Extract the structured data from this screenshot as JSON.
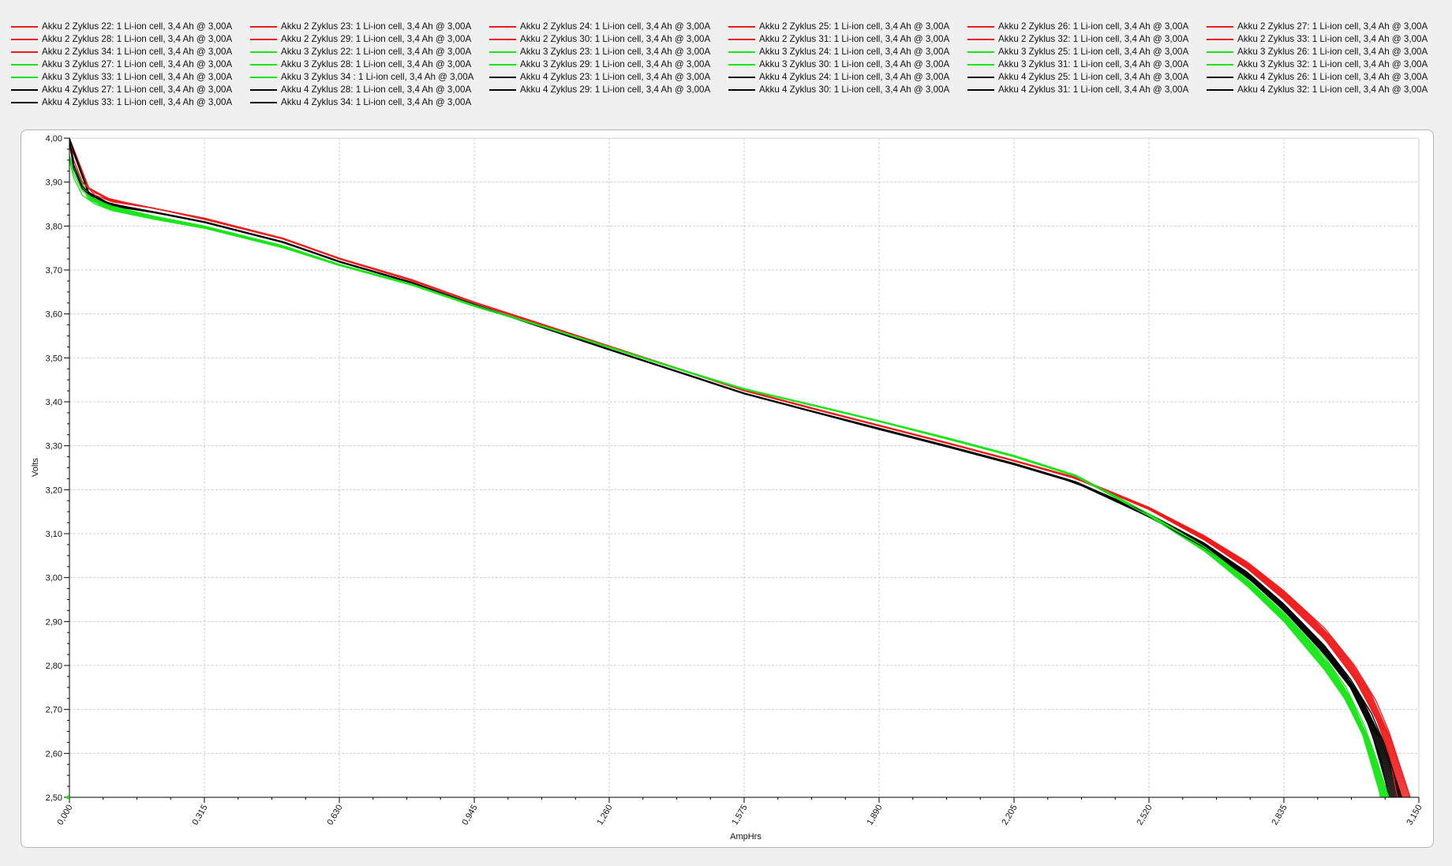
{
  "colors": {
    "red": "#ee1c1c",
    "green": "#19e619",
    "black": "#000000"
  },
  "legend": [
    {
      "label": "Akku 2 Zyklus 22: 1 Li-ion cell, 3,4 Ah @ 3,00A",
      "color": "red"
    },
    {
      "label": "Akku 2 Zyklus 23: 1 Li-ion cell, 3,4 Ah @ 3,00A",
      "color": "red"
    },
    {
      "label": "Akku 2 Zyklus 24: 1 Li-ion cell, 3,4 Ah @ 3,00A",
      "color": "red"
    },
    {
      "label": "Akku 2 Zyklus 25: 1 Li-ion cell, 3,4 Ah @ 3,00A",
      "color": "red"
    },
    {
      "label": "Akku 2 Zyklus 26: 1 Li-ion cell, 3,4 Ah @ 3,00A",
      "color": "red"
    },
    {
      "label": "Akku 2 Zyklus 27: 1 Li-ion cell, 3,4 Ah @ 3,00A",
      "color": "red"
    },
    {
      "label": "Akku 2 Zyklus 28: 1 Li-ion cell, 3,4 Ah @ 3,00A",
      "color": "red"
    },
    {
      "label": "Akku 2 Zyklus 29: 1 Li-ion cell, 3,4 Ah @ 3,00A",
      "color": "red"
    },
    {
      "label": "Akku 2 Zyklus 30: 1 Li-ion cell, 3,4 Ah @ 3,00A",
      "color": "red"
    },
    {
      "label": "Akku 2 Zyklus 31: 1 Li-ion cell, 3,4 Ah @ 3,00A",
      "color": "red"
    },
    {
      "label": "Akku 2 Zyklus 32: 1 Li-ion cell, 3,4 Ah @ 3,00A",
      "color": "red"
    },
    {
      "label": "Akku 2 Zyklus 33: 1 Li-ion cell, 3,4 Ah @ 3,00A",
      "color": "red"
    },
    {
      "label": "Akku 2 Zyklus 34: 1 Li-ion cell, 3,4 Ah @ 3,00A",
      "color": "red"
    },
    {
      "label": "Akku 3 Zyklus 22: 1 Li-ion cell, 3,4 Ah @ 3,00A",
      "color": "green"
    },
    {
      "label": "Akku 3 Zyklus 23: 1 Li-ion cell, 3,4 Ah @ 3,00A",
      "color": "green"
    },
    {
      "label": "Akku 3 Zyklus 24: 1 Li-ion cell, 3,4 Ah @ 3,00A",
      "color": "green"
    },
    {
      "label": "Akku 3 Zyklus 25: 1 Li-ion cell, 3,4 Ah @ 3,00A",
      "color": "green"
    },
    {
      "label": "Akku 3 Zyklus 26: 1 Li-ion cell, 3,4 Ah @ 3,00A",
      "color": "green"
    },
    {
      "label": "Akku 3 Zyklus 27: 1 Li-ion cell, 3,4 Ah @ 3,00A",
      "color": "green"
    },
    {
      "label": "Akku 3 Zyklus 28: 1 Li-ion cell, 3,4 Ah @ 3,00A",
      "color": "green"
    },
    {
      "label": "Akku 3 Zyklus 29: 1 Li-ion cell, 3,4 Ah @ 3,00A",
      "color": "green"
    },
    {
      "label": "Akku 3 Zyklus 30: 1 Li-ion cell, 3,4 Ah @ 3,00A",
      "color": "green"
    },
    {
      "label": "Akku 3 Zyklus 31: 1 Li-ion cell, 3,4 Ah @ 3,00A",
      "color": "green"
    },
    {
      "label": "Akku 3 Zyklus 32: 1 Li-ion cell, 3,4 Ah @ 3,00A",
      "color": "green"
    },
    {
      "label": "Akku 3 Zyklus 33: 1 Li-ion cell, 3,4 Ah @ 3,00A",
      "color": "green"
    },
    {
      "label": "Akku 3 Zyklus 34 : 1 Li-ion cell, 3,4 Ah @ 3,00A",
      "color": "green"
    },
    {
      "label": "Akku 4 Zyklus 23: 1 Li-ion cell, 3,4 Ah @ 3,00A",
      "color": "black"
    },
    {
      "label": "Akku 4 Zyklus 24: 1 Li-ion cell, 3,4 Ah @ 3,00A",
      "color": "black"
    },
    {
      "label": "Akku 4 Zyklus 25: 1 Li-ion cell, 3,4 Ah @ 3,00A",
      "color": "black"
    },
    {
      "label": "Akku 4 Zyklus 26: 1 Li-ion cell, 3,4 Ah @ 3,00A",
      "color": "black"
    },
    {
      "label": "Akku 4 Zyklus 27: 1 Li-ion cell, 3,4 Ah @ 3,00A",
      "color": "black"
    },
    {
      "label": "Akku 4 Zyklus 28: 1 Li-ion cell, 3,4 Ah @ 3,00A",
      "color": "black"
    },
    {
      "label": "Akku 4 Zyklus 29: 1 Li-ion cell, 3,4 Ah @ 3,00A",
      "color": "black"
    },
    {
      "label": "Akku 4 Zyklus 30: 1 Li-ion cell, 3,4 Ah @ 3,00A",
      "color": "black"
    },
    {
      "label": "Akku 4 Zyklus 31: 1 Li-ion cell, 3,4 Ah @ 3,00A",
      "color": "black"
    },
    {
      "label": "Akku 4 Zyklus 32: 1 Li-ion cell, 3,4 Ah @ 3,00A",
      "color": "black"
    },
    {
      "label": "Akku 4 Zyklus 33: 1 Li-ion cell, 3,4 Ah @ 3,00A",
      "color": "black"
    },
    {
      "label": "Akku 4 Zyklus 34: 1 Li-ion cell, 3,4 Ah @ 3,00A",
      "color": "black"
    }
  ],
  "chart_data": {
    "type": "line",
    "title": "",
    "xlabel": "AmpHrs",
    "ylabel": "Volts",
    "xlim": [
      0,
      3.15
    ],
    "ylim": [
      2.5,
      4.0
    ],
    "grid": true,
    "legend_position": "top",
    "xticks": [
      "0,000",
      "0,315",
      "0,630",
      "0,945",
      "1,260",
      "1,575",
      "1,890",
      "2,205",
      "2,520",
      "2,835",
      "3,150"
    ],
    "yticks": [
      "2,50",
      "2,60",
      "2,70",
      "2,80",
      "2,90",
      "3,00",
      "3,10",
      "3,20",
      "3,30",
      "3,40",
      "3,50",
      "3,60",
      "3,70",
      "3,80",
      "3,90",
      "4,00"
    ],
    "series": [
      {
        "name": "Akku 2 Zyklus 22: 1 Li-ion cell, 3,4 Ah @ 3,00A",
        "group": "red",
        "x": [
          0,
          0.01,
          0.03,
          0.06,
          0.1,
          0.2,
          0.315,
          0.5,
          0.63,
          0.8,
          0.945,
          1.1,
          1.26,
          1.45,
          1.575,
          1.75,
          1.89,
          2.05,
          2.205,
          2.35,
          2.52,
          2.65,
          2.75,
          2.835,
          2.93,
          3.0,
          3.05,
          3.08,
          3.1
        ],
        "y": [
          4.0,
          3.95,
          3.9,
          3.87,
          3.855,
          3.84,
          3.815,
          3.77,
          3.725,
          3.675,
          3.625,
          3.575,
          3.525,
          3.465,
          3.425,
          3.38,
          3.345,
          3.305,
          3.265,
          3.225,
          3.155,
          3.085,
          3.02,
          2.95,
          2.86,
          2.77,
          2.68,
          2.6,
          2.5
        ]
      },
      {
        "name": "Akku 2 Zyklus 30: 1 Li-ion cell, 3,4 Ah @ 3,00A",
        "group": "red",
        "x": [
          0,
          0.01,
          0.03,
          0.06,
          0.1,
          0.2,
          0.315,
          0.5,
          0.63,
          0.8,
          0.945,
          1.1,
          1.26,
          1.45,
          1.575,
          1.75,
          1.89,
          2.05,
          2.205,
          2.35,
          2.52,
          2.65,
          2.75,
          2.835,
          2.93,
          3.0,
          3.05,
          3.08,
          3.13
        ],
        "y": [
          4.0,
          3.95,
          3.9,
          3.875,
          3.86,
          3.84,
          3.818,
          3.772,
          3.727,
          3.678,
          3.627,
          3.578,
          3.527,
          3.467,
          3.427,
          3.382,
          3.347,
          3.307,
          3.267,
          3.228,
          3.16,
          3.095,
          3.035,
          2.97,
          2.885,
          2.8,
          2.72,
          2.65,
          2.5
        ]
      },
      {
        "name": "Akku 3 Zyklus 22: 1 Li-ion cell, 3,4 Ah @ 3,00A",
        "group": "green",
        "x": [
          0,
          0.01,
          0.03,
          0.06,
          0.1,
          0.2,
          0.315,
          0.5,
          0.63,
          0.8,
          0.945,
          1.1,
          1.26,
          1.45,
          1.575,
          1.75,
          1.89,
          2.05,
          2.205,
          2.35,
          2.52,
          2.65,
          2.75,
          2.835,
          2.93,
          2.98,
          3.02,
          3.05,
          3.06
        ],
        "y": [
          3.95,
          3.91,
          3.87,
          3.85,
          3.835,
          3.815,
          3.795,
          3.75,
          3.71,
          3.665,
          3.617,
          3.572,
          3.523,
          3.465,
          3.428,
          3.388,
          3.355,
          3.315,
          3.275,
          3.23,
          3.14,
          3.06,
          2.98,
          2.9,
          2.79,
          2.72,
          2.64,
          2.56,
          2.5
        ]
      },
      {
        "name": "Akku 3 Zyklus 30: 1 Li-ion cell, 3,4 Ah @ 3,00A",
        "group": "green",
        "x": [
          0,
          0.01,
          0.03,
          0.06,
          0.1,
          0.2,
          0.315,
          0.5,
          0.63,
          0.8,
          0.945,
          1.1,
          1.26,
          1.45,
          1.575,
          1.75,
          1.89,
          2.05,
          2.205,
          2.35,
          2.52,
          2.65,
          2.75,
          2.835,
          2.93,
          2.98,
          3.02,
          3.05,
          3.08
        ],
        "y": [
          3.96,
          3.92,
          3.88,
          3.86,
          3.845,
          3.822,
          3.8,
          3.755,
          3.713,
          3.668,
          3.62,
          3.574,
          3.525,
          3.467,
          3.43,
          3.39,
          3.357,
          3.318,
          3.278,
          3.233,
          3.145,
          3.07,
          2.995,
          2.92,
          2.82,
          2.75,
          2.67,
          2.59,
          2.5
        ]
      },
      {
        "name": "Akku 4 Zyklus 23: 1 Li-ion cell, 3,4 Ah @ 3,00A",
        "group": "black",
        "x": [
          0,
          0.01,
          0.03,
          0.06,
          0.1,
          0.2,
          0.315,
          0.5,
          0.63,
          0.8,
          0.945,
          1.1,
          1.26,
          1.45,
          1.575,
          1.75,
          1.89,
          2.05,
          2.205,
          2.35,
          2.52,
          2.65,
          2.75,
          2.835,
          2.93,
          2.99,
          3.03,
          3.06,
          3.08
        ],
        "y": [
          3.99,
          3.93,
          3.885,
          3.86,
          3.845,
          3.83,
          3.808,
          3.762,
          3.718,
          3.67,
          3.62,
          3.57,
          3.518,
          3.458,
          3.418,
          3.373,
          3.337,
          3.297,
          3.257,
          3.215,
          3.138,
          3.068,
          3.0,
          2.925,
          2.825,
          2.75,
          2.67,
          2.59,
          2.5
        ]
      },
      {
        "name": "Akku 4 Zyklus 34: 1 Li-ion cell, 3,4 Ah @ 3,00A",
        "group": "black",
        "x": [
          0,
          0.01,
          0.03,
          0.06,
          0.1,
          0.2,
          0.315,
          0.5,
          0.63,
          0.8,
          0.945,
          1.1,
          1.26,
          1.45,
          1.575,
          1.75,
          1.89,
          2.05,
          2.205,
          2.35,
          2.52,
          2.65,
          2.75,
          2.835,
          2.93,
          2.99,
          3.04,
          3.07,
          3.11
        ],
        "y": [
          4.0,
          3.94,
          3.89,
          3.865,
          3.85,
          3.832,
          3.81,
          3.764,
          3.72,
          3.672,
          3.622,
          3.572,
          3.52,
          3.46,
          3.42,
          3.375,
          3.34,
          3.3,
          3.26,
          3.218,
          3.145,
          3.078,
          3.012,
          2.94,
          2.845,
          2.77,
          2.69,
          2.62,
          2.5
        ]
      }
    ]
  }
}
